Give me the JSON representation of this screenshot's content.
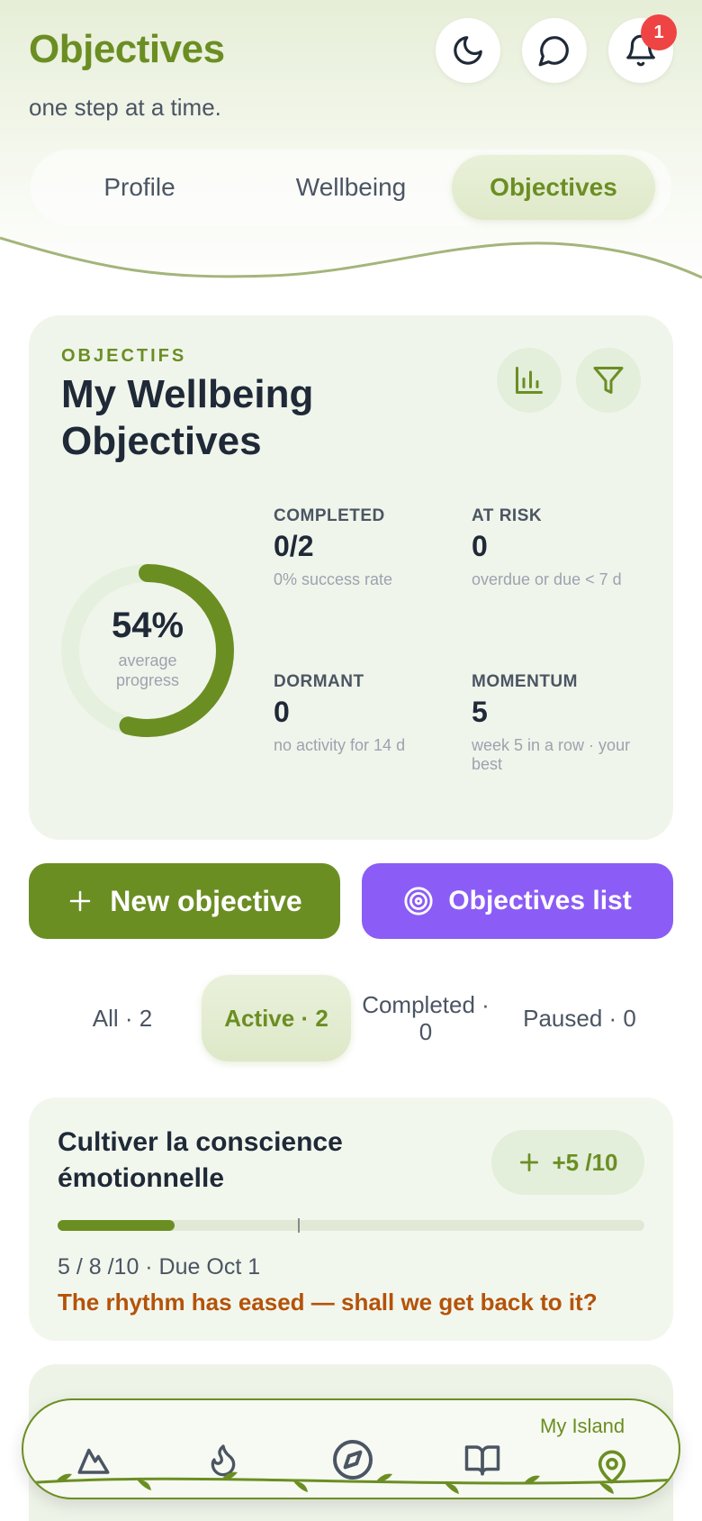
{
  "header": {
    "title": "Objectives",
    "subtitle": "one step at a time.",
    "notification_count": "1"
  },
  "tabs": [
    {
      "label": "Profile",
      "active": false
    },
    {
      "label": "Wellbeing",
      "active": false
    },
    {
      "label": "Objectives",
      "active": true
    }
  ],
  "summary": {
    "eyebrow": "OBJECTIFS",
    "title": "My Wellbeing Objectives",
    "progress": {
      "value": "54%",
      "fraction": 0.54,
      "label": "average progress"
    },
    "stats": [
      {
        "label": "COMPLETED",
        "value": "0/2",
        "sub": "0% success rate"
      },
      {
        "label": "AT RISK",
        "value": "0",
        "sub": "overdue or due < 7 d"
      },
      {
        "label": "DORMANT",
        "value": "0",
        "sub": "no activity for 14 d"
      },
      {
        "label": "MOMENTUM",
        "value": "5",
        "sub": "week 5 in a row · your best"
      }
    ]
  },
  "actions": {
    "new_label": "New objective",
    "list_label": "Objectives list"
  },
  "filters": [
    {
      "label": "All · 2",
      "active": false
    },
    {
      "label": "Active · 2",
      "active": true
    },
    {
      "label": "Completed · 0",
      "active": false
    },
    {
      "label": "Paused · 0",
      "active": false
    }
  ],
  "objective": {
    "title": "Cultiver la conscience émotionnelle",
    "increment": "+5 /10",
    "progress_fraction": 0.2,
    "target_fraction": 0.41,
    "meta": "5 / 8 /10 · Due Oct 1",
    "nudge": "The rhythm has eased — shall we get back to it?"
  },
  "nav": {
    "active_label": "My Island",
    "items": [
      "mountain-icon",
      "flame-icon",
      "compass-icon",
      "book-icon",
      "map-pin-icon"
    ]
  },
  "colors": {
    "accent": "#6b8e23",
    "purple": "#8b5cf6",
    "warning": "#b45309",
    "badge": "#ef4444"
  }
}
